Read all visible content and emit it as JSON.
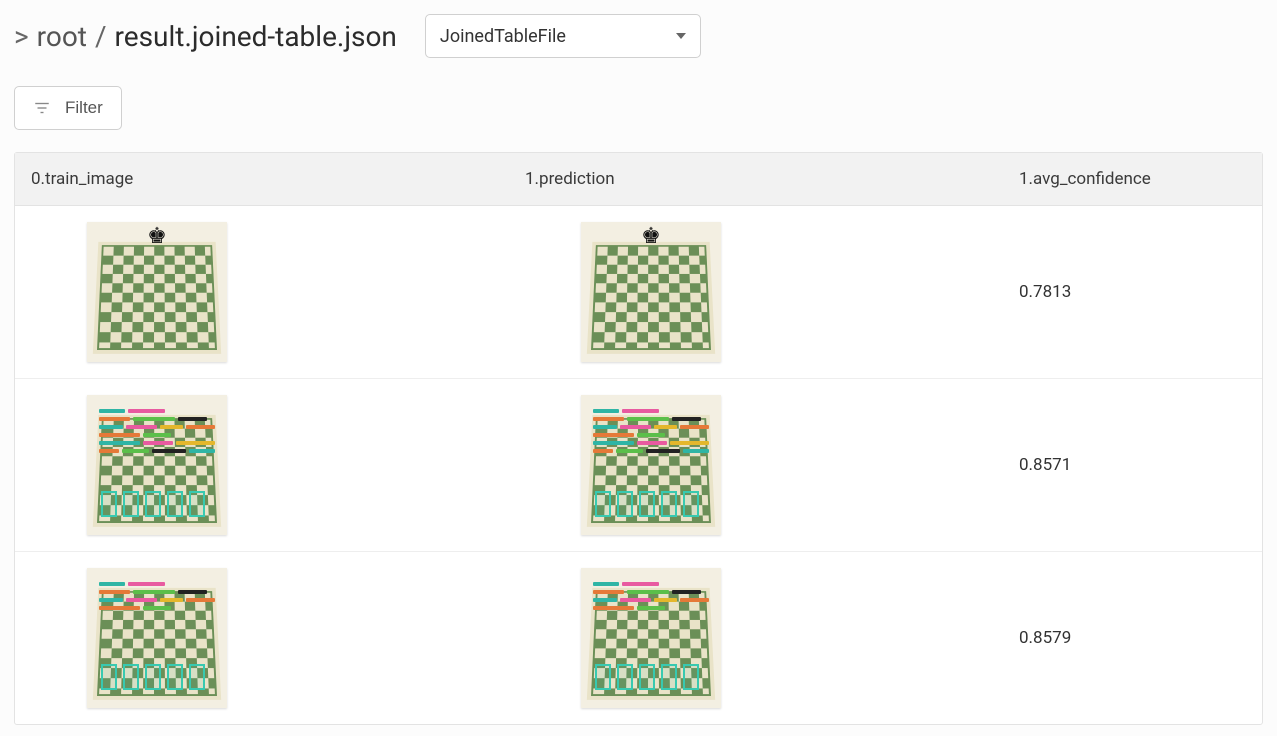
{
  "breadcrumb": {
    "chevron": ">",
    "root": "root",
    "sep": "/",
    "file": "result.joined-table.json"
  },
  "select": {
    "value": "JoinedTableFile"
  },
  "toolbar": {
    "filter_label": "Filter"
  },
  "table": {
    "columns": {
      "train_image": "0.train_image",
      "prediction": "1.prediction",
      "avg_confidence": "1.avg_confidence"
    },
    "rows": [
      {
        "avg_confidence": "0.7813",
        "variant": "sparse"
      },
      {
        "avg_confidence": "0.8571",
        "variant": "dense"
      },
      {
        "avg_confidence": "0.8579",
        "variant": "medium"
      }
    ]
  }
}
